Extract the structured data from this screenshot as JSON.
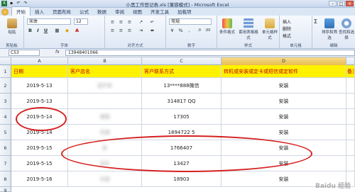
{
  "window": {
    "title": "小黑工作登记表.xls [兼容模式] - Microsoft Excel",
    "minimize": "–",
    "maximize": "□",
    "close": "×"
  },
  "ribbon_tabs": [
    "开始",
    "插入",
    "页面布局",
    "公式",
    "数据",
    "审阅",
    "视图",
    "开发工具",
    "加载项"
  ],
  "ribbon": {
    "paste_label": "粘贴",
    "clipboard_label": "剪贴板",
    "font_name": "宋体",
    "font_size": "12",
    "font_group_label": "字体",
    "bold": "B",
    "italic": "I",
    "underline": "U",
    "alignment_label": "对齐方式",
    "number_format": "常规",
    "number_label": "数字",
    "conditional_format": "条件格式",
    "table_format": "套用表格格式",
    "cell_style": "单元格样式",
    "styles_label": "样式",
    "insert": "插入",
    "delete": "删除",
    "format": "格式",
    "cells_label": "单元格",
    "sort_filter": "排序和筛选",
    "find_select": "查找和选择",
    "edit_label": "编辑"
  },
  "formula_bar": {
    "name_box": "C53",
    "fx": "fx",
    "value": "13948401066"
  },
  "sheet": {
    "columns": [
      "A",
      "B",
      "C",
      "D"
    ],
    "rows": [
      "1",
      "2",
      "3",
      "4",
      "5",
      "6",
      "7",
      "8",
      "9"
    ],
    "headers": {
      "a": "日期",
      "b": "客户店名",
      "c": "客户联系方式",
      "d": "转机或安装或定卡或短信或定软件",
      "e": "备注"
    },
    "data": [
      {
        "date": "2019-5-13",
        "store": "足疗床",
        "phone": "13****888微信",
        "task": "安装"
      },
      {
        "date": "2019-5-13",
        "store": "",
        "phone": "314817 QQ",
        "task": "安装"
      },
      {
        "date": "2019-5-14",
        "store": "酒馆",
        "phone": "17305",
        "task": "安装"
      },
      {
        "date": "2019-5-14",
        "store": "乐园",
        "phone": "1894722 5",
        "task": "安装"
      },
      {
        "date": "2019-5-15",
        "store": "床",
        "phone": "1766407",
        "task": "安装"
      },
      {
        "date": "2019-5-15",
        "store": "洗车",
        "phone": "13427",
        "task": "安装"
      },
      {
        "date": "2019-5-16",
        "store": "乐园",
        "phone": "18903",
        "task": "安装"
      }
    ]
  },
  "watermark": "Baidu 经验"
}
